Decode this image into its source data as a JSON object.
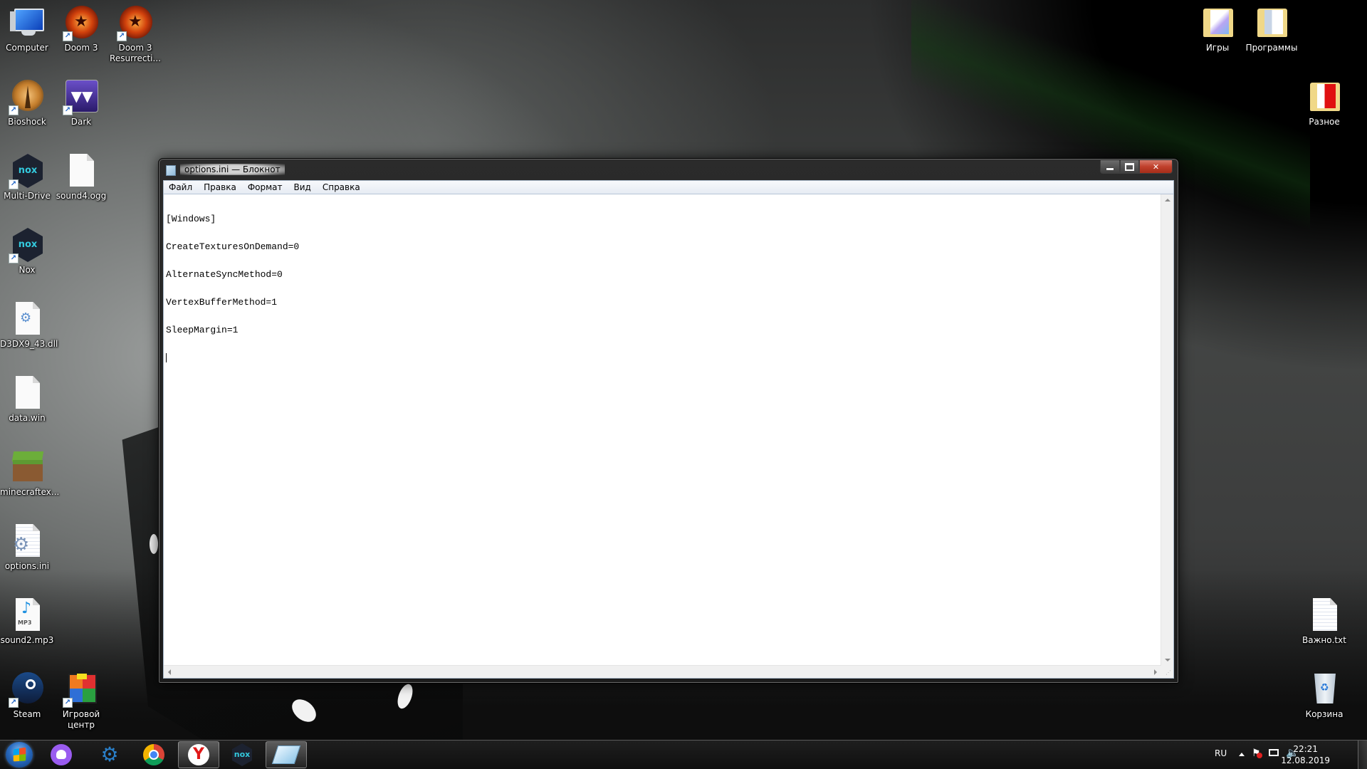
{
  "desktop": {
    "icons_left": [
      {
        "label": "Computer",
        "icon": "computer-icon",
        "shortcut": false
      },
      {
        "label": "Doom 3",
        "icon": "doom-pentagram-icon",
        "shortcut": true
      },
      {
        "label": "Doom 3 Resurrecti...",
        "icon": "doom-pentagram-icon",
        "shortcut": true
      },
      {
        "label": "Bioshock",
        "icon": "bioshock-icon",
        "shortcut": true
      },
      {
        "label": "Dark",
        "icon": "dark-fangs-icon",
        "shortcut": true
      },
      {
        "label": "Multi-Drive",
        "icon": "nox-multidrive-icon",
        "shortcut": true
      },
      {
        "label": "sound4.ogg",
        "icon": "blank-file-icon",
        "shortcut": false
      },
      {
        "label": "Nox",
        "icon": "nox-icon",
        "shortcut": true
      },
      {
        "label": "D3DX9_43.dll",
        "icon": "dll-file-icon",
        "shortcut": false
      },
      {
        "label": "data.win",
        "icon": "blank-file-icon",
        "shortcut": false
      },
      {
        "label": "minecraftex...",
        "icon": "minecraft-grass-block-icon",
        "shortcut": false
      },
      {
        "label": "options.ini",
        "icon": "ini-settings-file-icon",
        "shortcut": false
      },
      {
        "label": "sound2.mp3",
        "icon": "mp3-file-icon",
        "shortcut": false
      },
      {
        "label": "Steam",
        "icon": "steam-icon",
        "shortcut": true
      },
      {
        "label": "Игровой центр",
        "icon": "rubiks-cube-icon",
        "shortcut": true
      }
    ],
    "icons_right": [
      {
        "label": "Игры",
        "icon": "folder-icon"
      },
      {
        "label": "Программы",
        "icon": "folder-icon"
      },
      {
        "label": "Разное",
        "icon": "folder-icon"
      },
      {
        "label": "Важно.txt",
        "icon": "text-file-icon"
      },
      {
        "label": "Корзина",
        "icon": "recycle-bin-icon"
      }
    ],
    "mp3_badge": "MP3",
    "nox_logo": "nox"
  },
  "notepad": {
    "title": "options.ini — Блокнот",
    "menu": [
      "Файл",
      "Правка",
      "Формат",
      "Вид",
      "Справка"
    ],
    "lines": [
      "[Windows]",
      "CreateTexturesOnDemand=0",
      "AlternateSyncMethod=0",
      "VertexBufferMethod=1",
      "SleepMargin=1",
      ""
    ],
    "colors": {
      "close_button": "#c0402c",
      "menu_bg": "#e6ebf3"
    }
  },
  "taskbar": {
    "apps": [
      {
        "name": "alice-assistant",
        "active": false
      },
      {
        "name": "settings-shield",
        "active": false
      },
      {
        "name": "chrome",
        "active": false
      },
      {
        "name": "yandex-browser",
        "active": true
      },
      {
        "name": "nox",
        "active": false
      },
      {
        "name": "notepad",
        "active": true
      }
    ],
    "language": "RU",
    "time": "22:21",
    "date": "12.08.2019"
  }
}
